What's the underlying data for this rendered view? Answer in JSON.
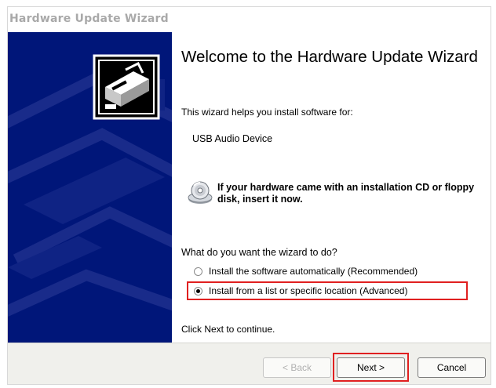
{
  "window": {
    "title": "Hardware Update Wizard"
  },
  "content": {
    "heading": "Welcome to the Hardware Update Wizard",
    "intro": "This wizard helps you install software for:",
    "device": "USB Audio Device",
    "cd_notice": "If your hardware came with an installation CD or floppy disk, insert it now.",
    "question": "What do you want the wizard to do?",
    "options": [
      {
        "label": "Install the software automatically (Recommended)",
        "selected": false
      },
      {
        "label": "Install from a list or specific location (Advanced)",
        "selected": true
      }
    ],
    "continue_text": "Click Next to continue."
  },
  "buttons": {
    "back": "< Back",
    "next": "Next >",
    "cancel": "Cancel"
  },
  "colors": {
    "side_panel": "#001679",
    "highlight": "#e02020",
    "footer": "#f0f0ec"
  },
  "icons": {
    "wizard": "hardware-wizard-icon",
    "cd": "cd-disc-icon"
  }
}
